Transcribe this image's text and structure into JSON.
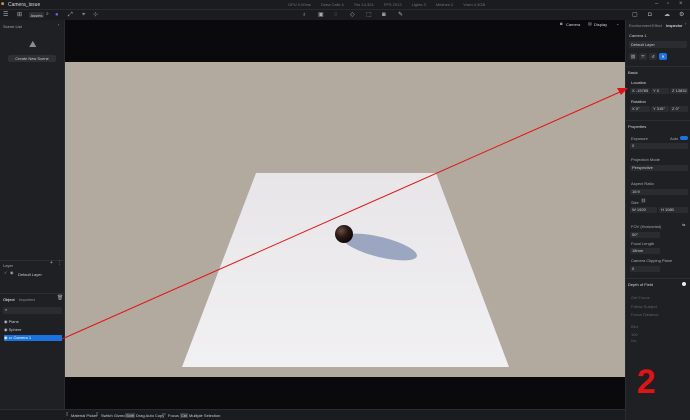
{
  "window": {
    "title": "Camera_issue"
  },
  "stats": [
    "GPU 0.00ms",
    "Draw Calls 4",
    "Tris 14,324",
    "FPS 2013",
    "Lights 3",
    "Meshes 2",
    "Vram 4.3GB"
  ],
  "toolbar": {
    "assets_label": "Assets"
  },
  "left_panel": {
    "scene_list_label": "Scene List",
    "create_scene_label": "Create New Scene",
    "layer_label": "Layer",
    "layer_item": "Default Layer",
    "object_tab": "Object",
    "imported_tab": "Imported",
    "objects": [
      "Plane",
      "Sphere",
      "Camera 1"
    ]
  },
  "viewport": {
    "camera_tab": "Camera",
    "display_tab": "Display"
  },
  "statusbar": {
    "items": [
      {
        "key": "",
        "label": "Material Picker"
      },
      {
        "key": "",
        "label": "Switch Gizmos"
      },
      {
        "key": "Shift",
        "label": "Drag Auto Copy"
      },
      {
        "key": "",
        "label": "Focus"
      },
      {
        "key": "Ctrl",
        "label": "Multiple Selection"
      }
    ]
  },
  "right_panel": {
    "tabs": [
      "Environment",
      "Effect",
      "Inspector"
    ],
    "object_name": "Camera 1",
    "layer_select": "Default Layer",
    "basic_label": "Basic",
    "location_label": "Location",
    "location": {
      "x": "-15785",
      "y": "0",
      "z": "13832"
    },
    "rotation_label": "Rotation",
    "rotation": {
      "x": "0°",
      "y": "315°",
      "z": "0°"
    },
    "properties_label": "Properties",
    "exposure_label": "Exposure",
    "auto_label": "Auto",
    "exposure_value": "0",
    "projection_label": "Projection Mode",
    "projection_value": "Perspective",
    "aspect_label": "Aspect Ratio",
    "aspect_value": "16:9",
    "size_label": "Size",
    "size_w": "1920",
    "size_h": "1080",
    "fov_label": "FOV (Horizontal)",
    "fov_value": "50°",
    "focal_label": "Focal Length",
    "focal_value": "18mm",
    "clip_label": "Camera Clipping Plane",
    "clip_value": "0",
    "dof_label": "Depth of Field",
    "dof_items": [
      "Get Focus",
      "Follow Subject",
      "Focus Distance",
      "Blur",
      "Iris"
    ],
    "dof_values": [
      "",
      "",
      "",
      "100",
      ""
    ]
  },
  "annotation": {
    "label": "2",
    "color": "#e01414"
  },
  "colors": {
    "accent": "#1a74e0",
    "floor": "#ecebed",
    "background": "#b2a99f"
  }
}
